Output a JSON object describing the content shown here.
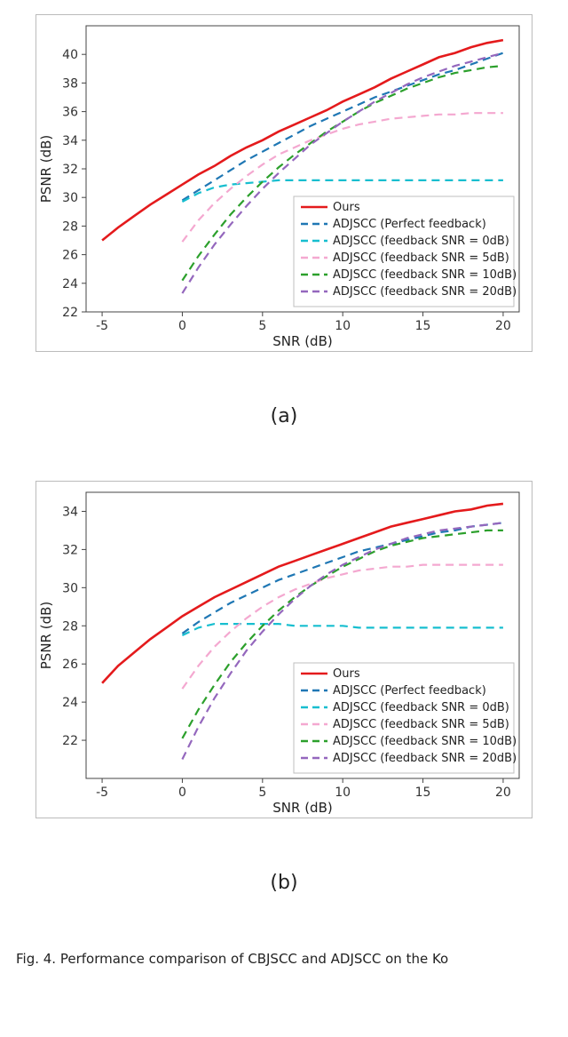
{
  "caption_text": "Fig. 4.   Performance comparison of CBJSCC and ADJSCC on the Ko",
  "subfigure_labels": {
    "a": "(a)",
    "b": "(b)"
  },
  "chart_data": [
    {
      "id": "a",
      "type": "line",
      "xlabel": "SNR (dB)",
      "ylabel": "PSNR (dB)",
      "xlim": [
        -6,
        21
      ],
      "ylim": [
        22,
        42
      ],
      "xticks": [
        -5,
        0,
        5,
        10,
        15,
        20
      ],
      "yticks": [
        22,
        24,
        26,
        28,
        30,
        32,
        34,
        36,
        38,
        40
      ],
      "grid": true,
      "legend_position": "lower-right",
      "series": [
        {
          "name": "Ours",
          "color": "#e41a1c",
          "style": "solid",
          "x": [
            -5,
            -4,
            -3,
            -2,
            -1,
            0,
            1,
            2,
            3,
            4,
            5,
            6,
            7,
            8,
            9,
            10,
            11,
            12,
            13,
            14,
            15,
            16,
            17,
            18,
            19,
            20
          ],
          "y": [
            27.0,
            27.9,
            28.7,
            29.5,
            30.2,
            30.9,
            31.6,
            32.2,
            32.9,
            33.5,
            34.0,
            34.6,
            35.1,
            35.6,
            36.1,
            36.7,
            37.2,
            37.7,
            38.3,
            38.8,
            39.3,
            39.8,
            40.1,
            40.5,
            40.8,
            41.0
          ]
        },
        {
          "name": "ADJSCC (Perfect feedback)",
          "color": "#1f77b4",
          "style": "dashed",
          "x": [
            0,
            1,
            2,
            3,
            4,
            5,
            6,
            7,
            8,
            9,
            10,
            11,
            12,
            13,
            14,
            15,
            16,
            17,
            18,
            19,
            20
          ],
          "y": [
            29.8,
            30.5,
            31.2,
            31.9,
            32.6,
            33.2,
            33.8,
            34.4,
            35.0,
            35.5,
            36.0,
            36.5,
            37.0,
            37.4,
            37.8,
            38.2,
            38.6,
            38.9,
            39.3,
            39.7,
            40.1
          ]
        },
        {
          "name": "ADJSCC (feedback SNR = 0dB)",
          "color": "#17becf",
          "style": "dashed",
          "x": [
            0,
            1,
            2,
            3,
            4,
            5,
            6,
            7,
            8,
            9,
            10,
            11,
            12,
            13,
            14,
            15,
            16,
            17,
            18,
            19,
            20
          ],
          "y": [
            29.7,
            30.3,
            30.7,
            30.9,
            31.0,
            31.1,
            31.2,
            31.2,
            31.2,
            31.2,
            31.2,
            31.2,
            31.2,
            31.2,
            31.2,
            31.2,
            31.2,
            31.2,
            31.2,
            31.2,
            31.2
          ]
        },
        {
          "name": "ADJSCC (feedback SNR = 5dB)",
          "color": "#f4a8d0",
          "style": "dashed",
          "x": [
            0,
            1,
            2,
            3,
            4,
            5,
            6,
            7,
            8,
            9,
            10,
            11,
            12,
            13,
            14,
            15,
            16,
            17,
            18,
            19,
            20
          ],
          "y": [
            26.9,
            28.4,
            29.6,
            30.6,
            31.5,
            32.3,
            33.0,
            33.5,
            34.0,
            34.4,
            34.8,
            35.1,
            35.3,
            35.5,
            35.6,
            35.7,
            35.8,
            35.8,
            35.9,
            35.9,
            35.9
          ]
        },
        {
          "name": "ADJSCC (feedback SNR = 10dB)",
          "color": "#2ca02c",
          "style": "dashed",
          "x": [
            0,
            1,
            2,
            3,
            4,
            5,
            6,
            7,
            8,
            9,
            10,
            11,
            12,
            13,
            14,
            15,
            16,
            17,
            18,
            19,
            20
          ],
          "y": [
            24.2,
            25.9,
            27.4,
            28.8,
            30.0,
            31.1,
            32.1,
            33.0,
            33.8,
            34.6,
            35.3,
            36.0,
            36.6,
            37.1,
            37.6,
            38.0,
            38.4,
            38.7,
            38.9,
            39.1,
            39.2
          ]
        },
        {
          "name": "ADJSCC (feedback SNR = 20dB)",
          "color": "#9467bd",
          "style": "dashed",
          "x": [
            0,
            1,
            2,
            3,
            4,
            5,
            6,
            7,
            8,
            9,
            10,
            11,
            12,
            13,
            14,
            15,
            16,
            17,
            18,
            19,
            20
          ],
          "y": [
            23.3,
            25.1,
            26.7,
            28.1,
            29.4,
            30.6,
            31.7,
            32.7,
            33.7,
            34.5,
            35.3,
            36.0,
            36.7,
            37.3,
            37.9,
            38.4,
            38.8,
            39.2,
            39.5,
            39.8,
            40.1
          ]
        }
      ]
    },
    {
      "id": "b",
      "type": "line",
      "xlabel": "SNR (dB)",
      "ylabel": "PSNR (dB)",
      "xlim": [
        -6,
        21
      ],
      "ylim": [
        20,
        35
      ],
      "xticks": [
        -5,
        0,
        5,
        10,
        15,
        20
      ],
      "yticks": [
        22,
        24,
        26,
        28,
        30,
        32,
        34
      ],
      "grid": true,
      "legend_position": "lower-right",
      "series": [
        {
          "name": "Ours",
          "color": "#e41a1c",
          "style": "solid",
          "x": [
            -5,
            -4,
            -3,
            -2,
            -1,
            0,
            1,
            2,
            3,
            4,
            5,
            6,
            7,
            8,
            9,
            10,
            11,
            12,
            13,
            14,
            15,
            16,
            17,
            18,
            19,
            20
          ],
          "y": [
            25.0,
            25.9,
            26.6,
            27.3,
            27.9,
            28.5,
            29.0,
            29.5,
            29.9,
            30.3,
            30.7,
            31.1,
            31.4,
            31.7,
            32.0,
            32.3,
            32.6,
            32.9,
            33.2,
            33.4,
            33.6,
            33.8,
            34.0,
            34.1,
            34.3,
            34.4
          ]
        },
        {
          "name": "ADJSCC (Perfect feedback)",
          "color": "#1f77b4",
          "style": "dashed",
          "x": [
            0,
            1,
            2,
            3,
            4,
            5,
            6,
            7,
            8,
            9,
            10,
            11,
            12,
            13,
            14,
            15,
            16,
            17,
            18,
            19,
            20
          ],
          "y": [
            27.6,
            28.2,
            28.7,
            29.2,
            29.6,
            30.0,
            30.4,
            30.7,
            31.0,
            31.3,
            31.6,
            31.9,
            32.1,
            32.3,
            32.5,
            32.7,
            32.9,
            33.0,
            33.2,
            33.3,
            33.4
          ]
        },
        {
          "name": "ADJSCC (feedback SNR = 0dB)",
          "color": "#17becf",
          "style": "dashed",
          "x": [
            0,
            1,
            2,
            3,
            4,
            5,
            6,
            7,
            8,
            9,
            10,
            11,
            12,
            13,
            14,
            15,
            16,
            17,
            18,
            19,
            20
          ],
          "y": [
            27.5,
            27.9,
            28.1,
            28.1,
            28.1,
            28.1,
            28.1,
            28.0,
            28.0,
            28.0,
            28.0,
            27.9,
            27.9,
            27.9,
            27.9,
            27.9,
            27.9,
            27.9,
            27.9,
            27.9,
            27.9
          ]
        },
        {
          "name": "ADJSCC (feedback SNR = 5dB)",
          "color": "#f4a8d0",
          "style": "dashed",
          "x": [
            0,
            1,
            2,
            3,
            4,
            5,
            6,
            7,
            8,
            9,
            10,
            11,
            12,
            13,
            14,
            15,
            16,
            17,
            18,
            19,
            20
          ],
          "y": [
            24.7,
            25.9,
            26.9,
            27.7,
            28.4,
            29.0,
            29.5,
            29.9,
            30.2,
            30.5,
            30.7,
            30.9,
            31.0,
            31.1,
            31.1,
            31.2,
            31.2,
            31.2,
            31.2,
            31.2,
            31.2
          ]
        },
        {
          "name": "ADJSCC (feedback SNR = 10dB)",
          "color": "#2ca02c",
          "style": "dashed",
          "x": [
            0,
            1,
            2,
            3,
            4,
            5,
            6,
            7,
            8,
            9,
            10,
            11,
            12,
            13,
            14,
            15,
            16,
            17,
            18,
            19,
            20
          ],
          "y": [
            22.1,
            23.6,
            24.9,
            26.1,
            27.1,
            28.0,
            28.8,
            29.5,
            30.1,
            30.6,
            31.1,
            31.5,
            31.9,
            32.2,
            32.4,
            32.6,
            32.7,
            32.8,
            32.9,
            33.0,
            33.0
          ]
        },
        {
          "name": "ADJSCC (feedback SNR = 20dB)",
          "color": "#9467bd",
          "style": "dashed",
          "x": [
            0,
            1,
            2,
            3,
            4,
            5,
            6,
            7,
            8,
            9,
            10,
            11,
            12,
            13,
            14,
            15,
            16,
            17,
            18,
            19,
            20
          ],
          "y": [
            21.0,
            22.7,
            24.2,
            25.5,
            26.7,
            27.7,
            28.6,
            29.4,
            30.1,
            30.7,
            31.2,
            31.6,
            32.0,
            32.3,
            32.6,
            32.8,
            33.0,
            33.1,
            33.2,
            33.3,
            33.4
          ]
        }
      ]
    }
  ]
}
